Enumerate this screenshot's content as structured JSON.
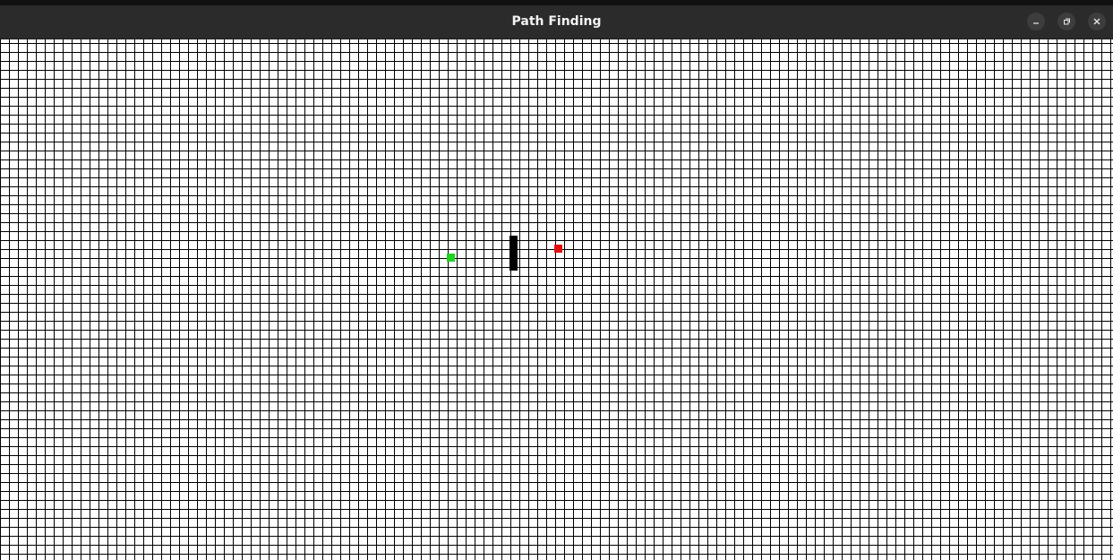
{
  "window": {
    "title": "Path Finding",
    "controls": {
      "minimize_icon": "minimize-icon",
      "maximize_icon": "maximize-icon",
      "close_icon": "close-icon"
    }
  },
  "grid": {
    "colors": {
      "background": "#ffffff",
      "lines": "#000000",
      "start": "#1ed21e",
      "end": "#e01010",
      "wall": "#000000"
    },
    "start_node": "start",
    "end_node": "end",
    "walls": [
      "wall"
    ]
  }
}
